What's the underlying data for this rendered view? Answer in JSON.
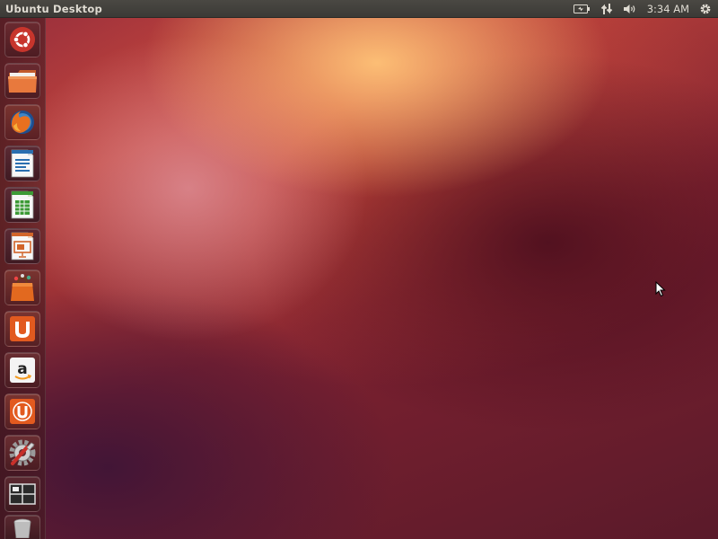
{
  "panel": {
    "title": "Ubuntu Desktop",
    "clock": "3:34 AM"
  },
  "indicators": [
    {
      "name": "battery-icon"
    },
    {
      "name": "network-icon"
    },
    {
      "name": "volume-icon"
    },
    {
      "name": "gear-icon"
    }
  ],
  "launcher": {
    "items": [
      {
        "name": "dash-home-button",
        "icon": "ubuntu-logo-icon"
      },
      {
        "name": "files-button",
        "icon": "folder-icon"
      },
      {
        "name": "firefox-button",
        "icon": "firefox-icon"
      },
      {
        "name": "libreoffice-writer-button",
        "icon": "writer-icon"
      },
      {
        "name": "libreoffice-calc-button",
        "icon": "calc-icon"
      },
      {
        "name": "libreoffice-impress-button",
        "icon": "impress-icon"
      },
      {
        "name": "software-center-button",
        "icon": "shopping-bag-icon"
      },
      {
        "name": "ubuntu-one-button",
        "icon": "ubuntu-one-icon"
      },
      {
        "name": "amazon-button",
        "icon": "amazon-icon"
      },
      {
        "name": "ubuntu-one-music-button",
        "icon": "ubuntu-one-music-icon"
      },
      {
        "name": "system-settings-button",
        "icon": "settings-wrench-icon"
      },
      {
        "name": "workspace-switcher-button",
        "icon": "workspace-icon"
      },
      {
        "name": "trash-button",
        "icon": "trash-icon"
      }
    ]
  },
  "colors": {
    "panel_bg": "#3c3b37",
    "panel_text": "#dfdbd2",
    "ubuntu_orange": "#dd4814",
    "launcher_tint": "#4d1c22"
  }
}
